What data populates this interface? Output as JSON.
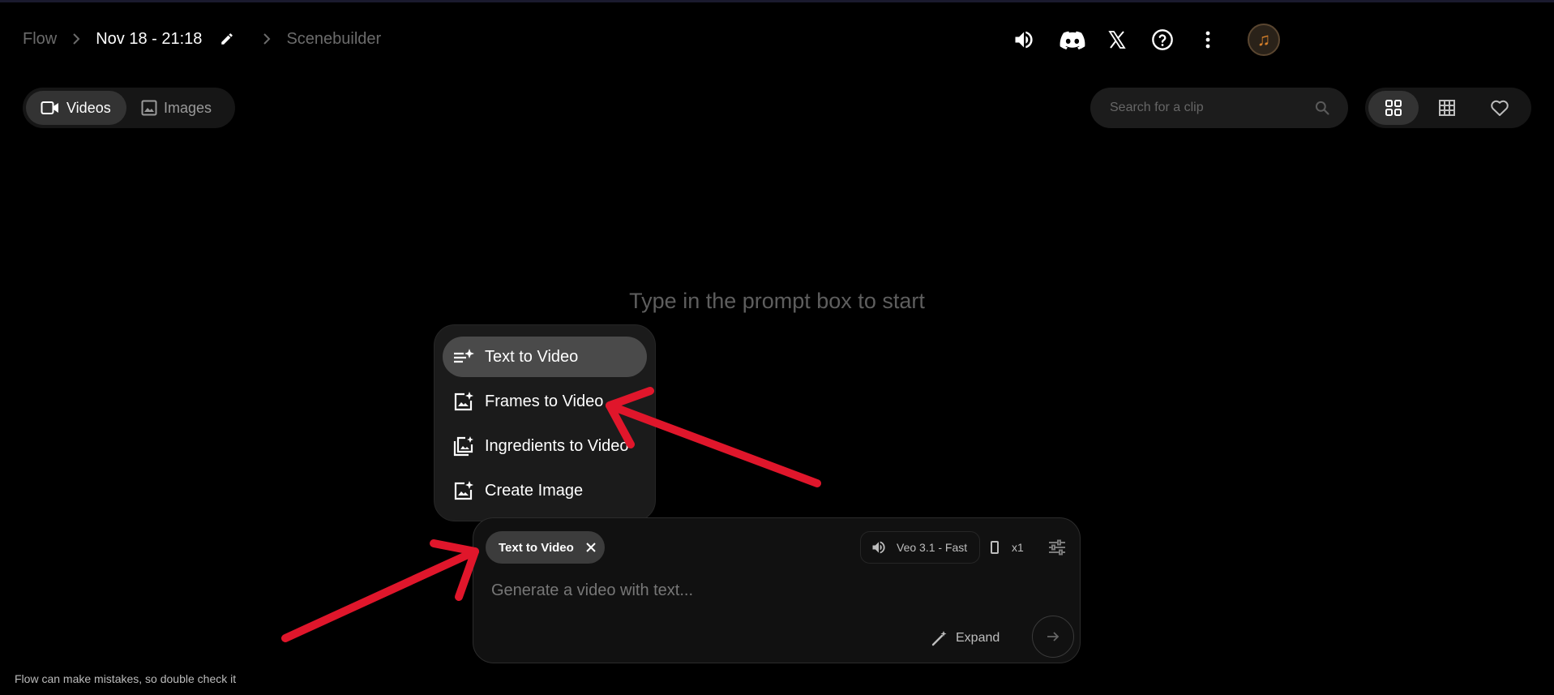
{
  "header": {
    "app_name": "Flow",
    "project_title": "Nov 18 - 21:18",
    "scene_label": "Scenebuilder"
  },
  "header_icons": [
    "volume-icon",
    "discord-icon",
    "x-icon",
    "help-icon",
    "more-vert-icon",
    "avatar"
  ],
  "tabs": [
    {
      "label": "Videos",
      "active": true
    },
    {
      "label": "Images",
      "active": false
    }
  ],
  "search": {
    "placeholder": "Search for a clip"
  },
  "view_toggles": [
    "grid-large-icon",
    "grid-small-icon",
    "favorites-heart-icon"
  ],
  "empty_state": {
    "hint": "Type in the prompt box to start"
  },
  "mode_menu": {
    "items": [
      {
        "label": "Text to Video",
        "icon": "text-sparkle-icon",
        "selected": true
      },
      {
        "label": "Frames to Video",
        "icon": "image-sparkle-icon",
        "selected": false
      },
      {
        "label": "Ingredients to Video",
        "icon": "images-stack-icon",
        "selected": false
      },
      {
        "label": "Create Image",
        "icon": "image-sparkle-icon",
        "selected": false
      }
    ]
  },
  "composer": {
    "mode_chip": "Text to Video",
    "model": "Veo 3.1 - Fast",
    "output_count": "x1",
    "prompt_placeholder": "Generate a video with text...",
    "expand_label": "Expand"
  },
  "footer": {
    "disclaimer": "Flow can make mistakes, so double check it"
  },
  "colors": {
    "background": "#000000",
    "annotation_arrow": "#e0162b",
    "menu_selected": "#4a4a4a"
  }
}
